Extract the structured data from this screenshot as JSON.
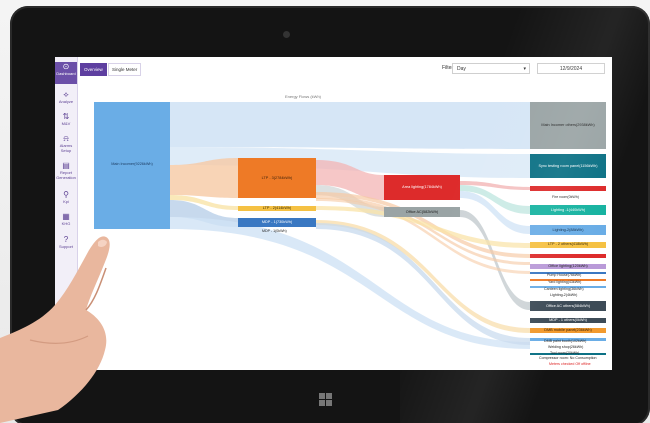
{
  "sidebar": {
    "items": [
      {
        "label": "Dashboard",
        "icon": "dashboard-icon",
        "glyph": "⊙",
        "active": true
      },
      {
        "label": "Analyze",
        "icon": "analyze-icon",
        "glyph": "⟡"
      },
      {
        "label": "M&V",
        "icon": "mv-icon",
        "glyph": "⇅"
      },
      {
        "label": "Alarms Setup",
        "icon": "alarm-icon",
        "glyph": "⍾"
      },
      {
        "label": "Report Generation",
        "icon": "report-icon",
        "glyph": "▤"
      },
      {
        "label": "Kpi",
        "icon": "kpi-icon",
        "glyph": "⚲"
      },
      {
        "label": "KHG",
        "icon": "khg-icon",
        "glyph": "▦"
      },
      {
        "label": "Support",
        "icon": "support-icon",
        "glyph": "?"
      }
    ]
  },
  "tabs": [
    {
      "label": "Overview",
      "active": true
    },
    {
      "label": "Single Meter",
      "active": false
    }
  ],
  "filter": {
    "label": "Filter",
    "value": "Day",
    "date": "12/9/2024"
  },
  "chart_data": {
    "type": "sankey",
    "title": "Energy Flows (kWh)",
    "nodes": [
      {
        "id": "main",
        "label": "Main Incomer(9226kWh)",
        "color": "#6aade6"
      },
      {
        "id": "ltp",
        "label": "LTP - 3(2784kWh)",
        "color": "#ee7a26"
      },
      {
        "id": "ltp2",
        "label": "LTP - 2(414kWh)",
        "color": "#f5c143"
      },
      {
        "id": "mdp",
        "label": "MDP - 1(730kWh)",
        "color": "#3a78c2"
      },
      {
        "id": "mdp1",
        "label": "MDP - 1(0kWh)",
        "color": "#3a78c2"
      },
      {
        "id": "area",
        "label": "Area lighting(1784kWh)",
        "color": "#dd2b2b"
      },
      {
        "id": "office",
        "label": "Office AC(582kWh)",
        "color": "#9aa4a5"
      },
      {
        "id": "mio",
        "label": "Main Incomer others(2938kWh)",
        "color": "#9aa4a5"
      },
      {
        "id": "sync",
        "label": "Sync testing room panel(1156kWh)",
        "color": "#0c7185"
      },
      {
        "id": "fire",
        "label": "Fire room(0kWh)",
        "color": "#dd2b2b"
      },
      {
        "id": "lig1",
        "label": "Lighting -1(440kWh)",
        "color": "#17b3a1"
      },
      {
        "id": "lig2",
        "label": "Lighting-2(88kWh)",
        "color": "#6aade6"
      },
      {
        "id": "ltpo",
        "label": "LTP - 2 others(418kWh)",
        "color": "#f5c143"
      },
      {
        "id": "off1",
        "label": "Office lighting(120kWh)",
        "color": "#b99ad8"
      },
      {
        "id": "pump",
        "label": "Pump House(76kWh)",
        "color": "#3a78c2"
      },
      {
        "id": "yard",
        "label": "Yard lighting(43kWh)",
        "color": "#ee7a26"
      },
      {
        "id": "cant",
        "label": "Canteen lighting(36kWh)",
        "color": "#6aade6"
      },
      {
        "id": "lig3",
        "label": "Lighting-2(4kWh)",
        "color": "#6aade6"
      },
      {
        "id": "offo",
        "label": "Office AC others(584kWh)",
        "color": "#3d4b57"
      },
      {
        "id": "mdpo",
        "label": "MDP - 1 others(0kWh)",
        "color": "#3d4b57"
      },
      {
        "id": "dmb",
        "label": "DMB mobile panel(236kWh)",
        "color": "#f29a2e"
      },
      {
        "id": "dmb2",
        "label": "DMB paint booth(102kWh)",
        "color": "#6aade6"
      },
      {
        "id": "weld",
        "label": "Welding shop(26kWh)",
        "color": "#222222"
      },
      {
        "id": "tool",
        "label": "Tool room(20kWh)",
        "color": "#0c7185"
      }
    ],
    "notes": [
      "Compressor room: No Consumption",
      "Meters checked Off offline"
    ]
  }
}
